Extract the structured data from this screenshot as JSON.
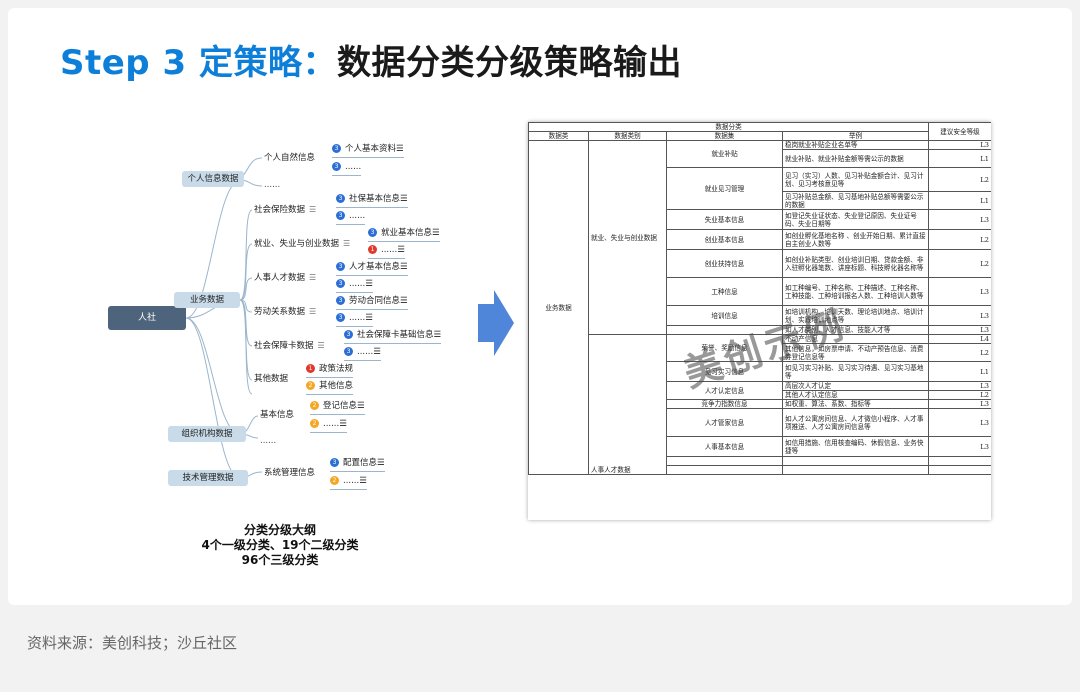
{
  "title": {
    "blue": "Step 3 定策略：",
    "black": "数据分类分级策略输出"
  },
  "source": "资料来源：美创科技；沙丘社区",
  "mindmap": {
    "root": "人社",
    "l1": [
      "个人信息数据",
      "业务数据",
      "组织机构数据",
      "技术管理数据"
    ],
    "l2": [
      "个人自然信息",
      "社会保险数据",
      "就业、失业与创业数据",
      "人事人才数据",
      "劳动关系数据",
      "社会保障卡数据",
      "其他数据",
      "基本信息",
      "系统管理信息"
    ],
    "leaves": [
      "个人基本资料",
      "社保基本信息",
      "就业基本信息",
      "人才基本信息",
      "劳动合同信息",
      "社会保障卡基础信息",
      "政策法规",
      "其他信息",
      "登记信息",
      "配置信息"
    ],
    "ellipsis": "......",
    "caption": [
      "分类分级大纲",
      "4个一级分类、19个二级分类",
      "96个三级分类"
    ]
  },
  "table": {
    "header_group": "数据分类",
    "headers": [
      "数据类",
      "数据类别",
      "数据集",
      "举例",
      "建议安全等级"
    ],
    "data_class": "业务数据",
    "categories": [
      "就业、失业与创业数据",
      "人事人才数据"
    ],
    "rows": [
      [
        "就业补贴",
        "稳岗就业补贴企业名单等",
        "L3"
      ],
      [
        "",
        "就业补贴、就业补贴金额等需公示的数据",
        "L1"
      ],
      [
        "就业见习管理",
        "见习（实习）人数、见习补贴金额合计、见习计划、见习考核意见等",
        "L2"
      ],
      [
        "",
        "见习补贴总金额、见习基地补贴总额等需要公示的数据",
        "L1"
      ],
      [
        "失业基本信息",
        "如登记失业证状态、失业登记原因、失业证号码、失业日期等",
        "L3"
      ],
      [
        "创业基本信息",
        "如创业孵化基地名称 、创业开始日期、累计直接自主创业人数等",
        "L2"
      ],
      [
        "创业扶持信息",
        "如创业补贴类型、创业培训日期、贷款金额、非入驻孵化器笔数、讲座标题、科技孵化器名称等",
        "L2"
      ],
      [
        "工种信息",
        "如工种编号、工种名称、工种描述、工种名称、工种技能、工种培训报名人数、工种培训人数等",
        "L3"
      ],
      [
        "培训信息",
        "如培训机构、培训天数、理论培训地点、培训计划、实践培训地点等",
        "L3"
      ],
      [
        "",
        "如人才类别、人才信息、技能人才等",
        "L3"
      ],
      [
        "荣誉、奖励信息",
        "不动产信息",
        "L4"
      ],
      [
        "",
        "其他信息，如房票申请、不动产预告信息、消费券登记信息等",
        "L2"
      ],
      [
        "见习实习信息",
        "如见习实习补贴、见习实习待遇、见习实习基地等",
        "L1"
      ],
      [
        "人才认定信息",
        "高层次人才认定",
        "L3"
      ],
      [
        "",
        "其他人才认定信息",
        "L2"
      ],
      [
        "竞争力指数信息",
        "如权重、算法、系数、指标等",
        "L3"
      ],
      [
        "人才管家信息",
        "如人才公寓房间信息、人才微信小程序、人才事项推送、人才公寓房间信息等",
        "L3"
      ],
      [
        "人事基本信息",
        "如信用措施、信用核查编码、休假信息、业务快捷等",
        "L3"
      ]
    ],
    "watermark": "美创示例"
  }
}
